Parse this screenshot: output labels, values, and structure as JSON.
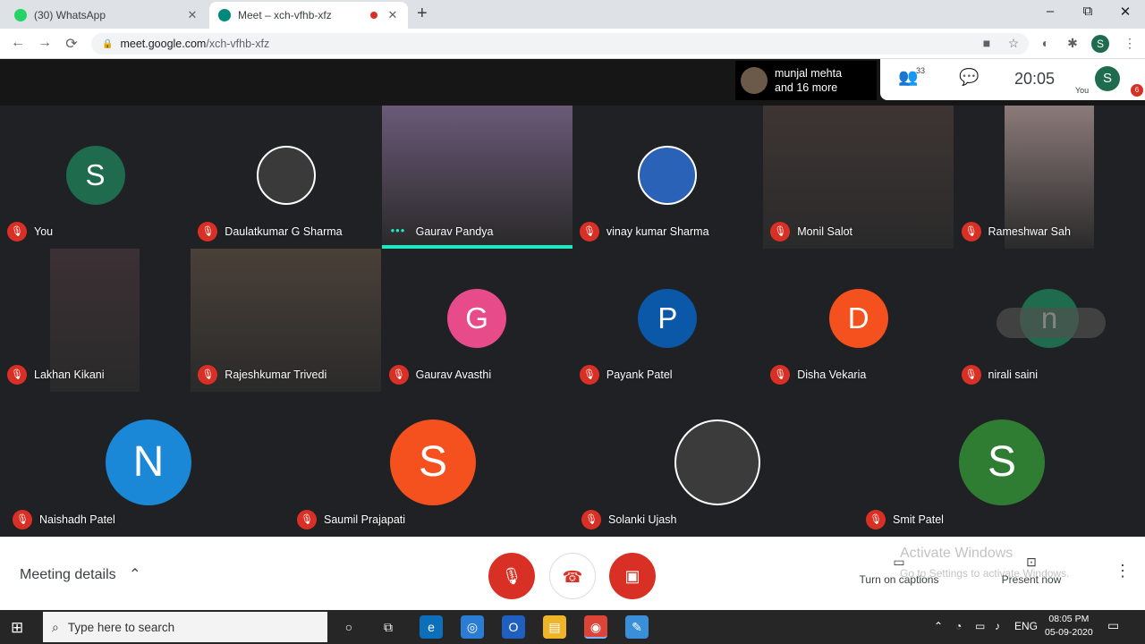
{
  "browser": {
    "tabs": [
      {
        "label": "(30) WhatsApp",
        "active": false,
        "fav_color": "#25d366"
      },
      {
        "label": "Meet – xch-vfhb-xfz",
        "active": true,
        "fav_color": "#00897b"
      }
    ],
    "new_tab": "+",
    "window_controls": {
      "minimize": "–",
      "maximize": "⧉",
      "close": "✕"
    },
    "nav": {
      "back": "←",
      "forward": "→",
      "reload": "⟳"
    },
    "url_host": "meet.google.com",
    "url_path": "/xch-vfhb-xfz",
    "profile_initial": "S"
  },
  "meet_header": {
    "presenter_line1": "munjal mehta",
    "presenter_line2": "and 16 more",
    "people_count": "33",
    "time": "20:05",
    "you_label": "You",
    "avatar_initial": "S",
    "badge": "6"
  },
  "participants": [
    {
      "name": "You",
      "type": "avatar",
      "initial": "S",
      "color": "#1e6b4e"
    },
    {
      "name": "Daulatkumar G Sharma",
      "type": "photo",
      "color": "#3a3a3a"
    },
    {
      "name": "Gaurav Pandya",
      "type": "video",
      "color": "#6a5a78",
      "speaking": true
    },
    {
      "name": "vinay kumar Sharma",
      "type": "photo",
      "color": "#2a62b8"
    },
    {
      "name": "Monil Salot",
      "type": "video",
      "color": "#3e3533"
    },
    {
      "name": "Rameshwar Sah",
      "type": "video",
      "color": "#8c7a7a"
    },
    {
      "name": "Lakhan Kikani",
      "type": "video",
      "color": "#3c3034"
    },
    {
      "name": "Rajeshkumar Trivedi",
      "type": "video",
      "color": "#4a4038"
    },
    {
      "name": "Gaurav Avasthi",
      "type": "avatar",
      "initial": "G",
      "color": "#e84b8a"
    },
    {
      "name": "Payank Patel",
      "type": "avatar",
      "initial": "P",
      "color": "#0b57a8"
    },
    {
      "name": "Disha Vekaria",
      "type": "avatar",
      "initial": "D",
      "color": "#f4511e"
    },
    {
      "name": "nirali saini",
      "type": "avatar",
      "initial": "n",
      "color": "#1e6b4e"
    },
    {
      "name": "Naishadh Patel",
      "type": "avatar",
      "initial": "N",
      "color": "#1a88d6"
    },
    {
      "name": "Saumil Prajapati",
      "type": "avatar",
      "initial": "S",
      "color": "#f4511e"
    },
    {
      "name": "Solanki Ujash",
      "type": "photo",
      "color": "#3b3b3b"
    },
    {
      "name": "Smit Patel",
      "type": "avatar",
      "initial": "S",
      "color": "#2e7d32"
    }
  ],
  "bottom_bar": {
    "meeting_details": "Meeting details",
    "chevron": "⌃",
    "captions_label": "Turn on captions",
    "present_label": "Present now",
    "watermark_title": "Activate Windows",
    "watermark_sub": "Go to Settings to activate Windows."
  },
  "taskbar": {
    "search_placeholder": "Type here to search",
    "lang": "ENG",
    "time": "08:05 PM",
    "date": "05-09-2020"
  }
}
